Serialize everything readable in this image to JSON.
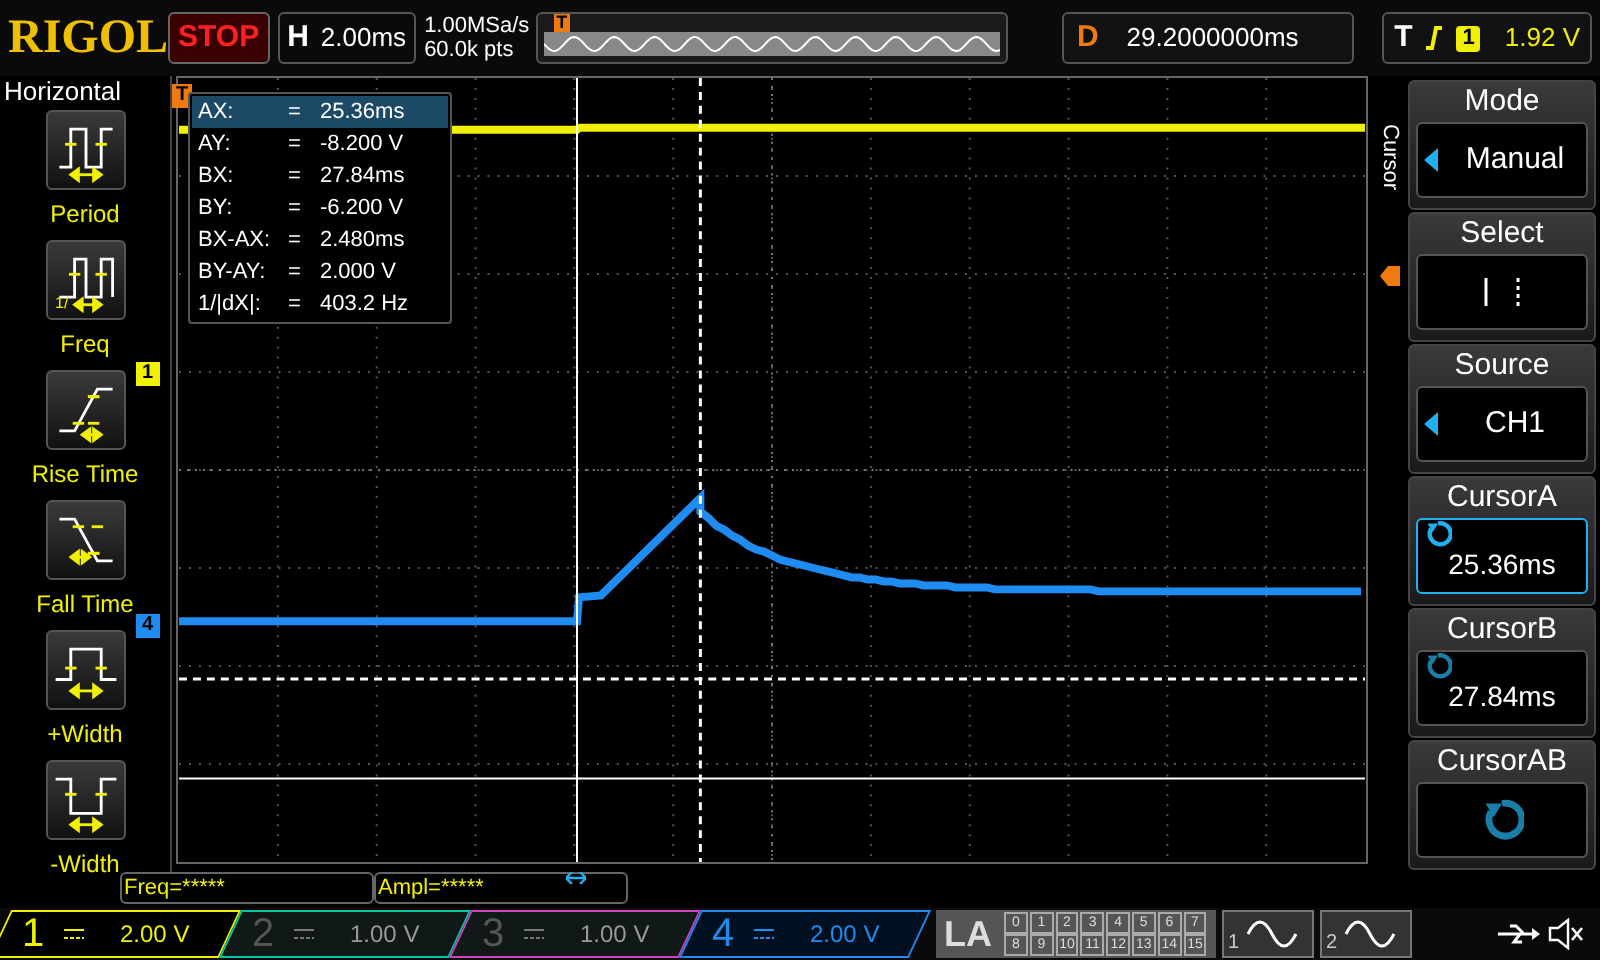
{
  "top_bar": {
    "brand": "RIGOL",
    "run_state": "STOP",
    "timebase": {
      "label": "H",
      "value": "2.00ms"
    },
    "sample_rate": "1.00MSa/s",
    "memory_depth": "60.0k pts",
    "memory_marker": "T",
    "delay": {
      "label": "D",
      "value": "29.2000000ms"
    },
    "trigger": {
      "label": "T",
      "source": "1",
      "level": "1.92 V"
    }
  },
  "left_menu": {
    "title": "Horizontal",
    "items": [
      {
        "kind": "period",
        "label": "Period"
      },
      {
        "kind": "freq",
        "label": "Freq",
        "fraction": "1/"
      },
      {
        "kind": "rise",
        "label": "Rise Time"
      },
      {
        "kind": "fall",
        "label": "Fall Time"
      },
      {
        "kind": "pwidth",
        "label": "+Width"
      },
      {
        "kind": "nwidth",
        "label": "-Width"
      }
    ]
  },
  "markers": [
    {
      "kind": "trigger",
      "text": "T",
      "color": "#f07a10"
    },
    {
      "kind": "ch1",
      "text": "1",
      "color": "#f0f000"
    },
    {
      "kind": "ch4",
      "text": "4",
      "color": "#1e8cf0"
    }
  ],
  "cursor_readout": {
    "rows": [
      {
        "label": "AX:",
        "eq": "=",
        "value": "25.36ms",
        "selected": true
      },
      {
        "label": "AY:",
        "eq": "=",
        "value": "-8.200 V",
        "selected": false
      },
      {
        "label": "BX:",
        "eq": "=",
        "value": "27.84ms",
        "selected": false
      },
      {
        "label": "BY:",
        "eq": "=",
        "value": "-6.200 V",
        "selected": false
      },
      {
        "label": "BX-AX:",
        "eq": "=",
        "value": "2.480ms",
        "selected": false
      },
      {
        "label": "BY-AY:",
        "eq": "=",
        "value": "2.000 V",
        "selected": false
      },
      {
        "label": "1/|dX|:",
        "eq": "=",
        "value": "403.2 Hz",
        "selected": false
      }
    ]
  },
  "right_menu": {
    "title": "Cursor",
    "items": [
      {
        "kind": "select",
        "label": "Mode",
        "value": "Manual"
      },
      {
        "kind": "cursor-select",
        "label": "Select"
      },
      {
        "kind": "select",
        "label": "Source",
        "value": "CH1"
      },
      {
        "kind": "knob",
        "label": "CursorA",
        "value": "25.36ms",
        "active": true
      },
      {
        "kind": "knob",
        "label": "CursorB",
        "value": "27.84ms",
        "active": false
      },
      {
        "kind": "knob-only",
        "label": "CursorAB",
        "active": false
      }
    ]
  },
  "statistics": [
    "Freq=*****",
    "Ampl=*****"
  ],
  "channels": [
    {
      "number": "1",
      "scale": "2.00 V",
      "color": "#f0f000",
      "enabled": true
    },
    {
      "number": "2",
      "scale": "1.00 V",
      "color": "#00c8a0",
      "enabled": false
    },
    {
      "number": "3",
      "scale": "1.00 V",
      "color": "#d040c0",
      "enabled": false
    },
    {
      "number": "4",
      "scale": "2.00 V",
      "color": "#1e8cf0",
      "enabled": true
    }
  ],
  "logic_analyzer": {
    "label": "LA",
    "bits": [
      "0",
      "1",
      "2",
      "3",
      "4",
      "5",
      "6",
      "7",
      "8",
      "9",
      "10",
      "11",
      "12",
      "13",
      "14",
      "15"
    ]
  },
  "generators": [
    "1",
    "2"
  ]
}
